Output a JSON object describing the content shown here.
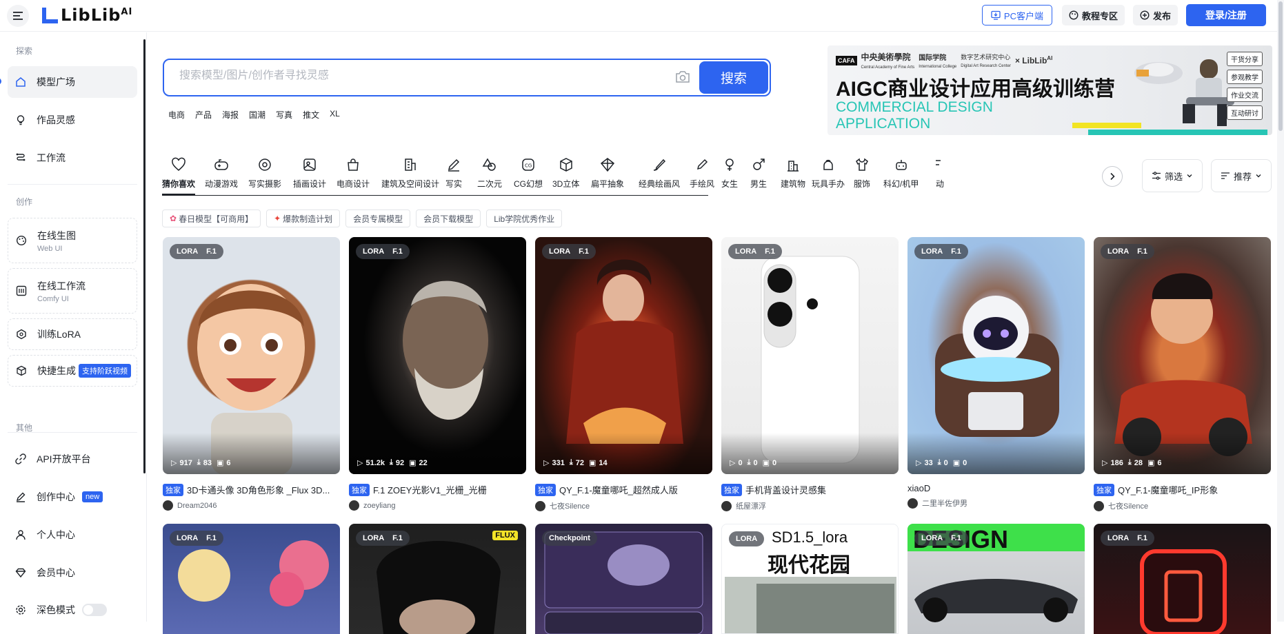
{
  "brand": {
    "logo_text": "LibLib",
    "logo_sup": "AI"
  },
  "header": {
    "client_btn": "PC客户端",
    "tutorial_btn": "教程专区",
    "publish_btn": "发布",
    "login_btn": "登录/注册"
  },
  "sidebar": {
    "section_explore": "探索",
    "explore_items": [
      {
        "label": "模型广场"
      },
      {
        "label": "作品灵感"
      },
      {
        "label": "工作流"
      }
    ],
    "section_create": "创作",
    "create_items": [
      {
        "label": "在线生图",
        "sub": "Web UI"
      },
      {
        "label": "在线工作流",
        "sub": "Comfy UI"
      },
      {
        "label": "训练LoRA"
      },
      {
        "label": "快捷生成",
        "tag": "支持阶跃视频"
      }
    ],
    "section_other": "其他",
    "other_items": [
      {
        "label": "API开放平台"
      },
      {
        "label": "创作中心",
        "tag": "new"
      },
      {
        "label": "个人中心"
      },
      {
        "label": "会员中心"
      },
      {
        "label": "深色模式"
      }
    ]
  },
  "search": {
    "placeholder": "搜索模型/图片/创作者寻找灵感",
    "button": "搜索",
    "quick_tags": [
      "电商",
      "产品",
      "海报",
      "国潮",
      "写真",
      "推文",
      "XL"
    ]
  },
  "banner": {
    "org1": "中央美術學院",
    "org1_en": "Central Academy of Fine Arts",
    "org2": "国际学院",
    "org2_en": "International College",
    "org3": "数字艺术研究中心",
    "org3_en": "Digital Art Research Center",
    "headline": "AIGC商业设计应用高级训练营",
    "en_line1": "COMMERCIAL DESIGN",
    "en_line2": "APPLICATION",
    "tags": [
      "干货分享",
      "参观教学",
      "作业交流",
      "互动研讨"
    ]
  },
  "categories": [
    {
      "label": "猜你喜欢",
      "icon": "heart-icon"
    },
    {
      "label": "动漫游戏",
      "icon": "gamepad-icon"
    },
    {
      "label": "写实摄影",
      "icon": "camera-icon"
    },
    {
      "label": "插画设计",
      "icon": "picture-icon"
    },
    {
      "label": "电商设计",
      "icon": "bag-icon"
    },
    {
      "label": "建筑及空间设计",
      "icon": "building-icon"
    },
    {
      "label": "写实",
      "icon": "pen-icon"
    },
    {
      "label": "二次元",
      "icon": "shapes-icon"
    },
    {
      "label": "CG幻想",
      "icon": "cg-icon"
    },
    {
      "label": "3D立体",
      "icon": "cube-icon"
    },
    {
      "label": "扁平抽象",
      "icon": "gem-icon"
    },
    {
      "label": "经典绘画风",
      "icon": "brush-icon"
    },
    {
      "label": "手绘风",
      "icon": "pencil-icon"
    },
    {
      "label": "女生",
      "icon": "female-icon"
    },
    {
      "label": "男生",
      "icon": "male-icon"
    },
    {
      "label": "建筑物",
      "icon": "city-icon"
    },
    {
      "label": "玩具手办",
      "icon": "toy-icon"
    },
    {
      "label": "服饰",
      "icon": "shirt-icon"
    },
    {
      "label": "科幻/机甲",
      "icon": "robot-icon"
    },
    {
      "label": "动",
      "icon": "more-icon"
    }
  ],
  "filter_btn": "筛选",
  "sort_btn": "推荐",
  "pills": [
    "春日模型【可商用】",
    "爆款制造计划",
    "会员专属模型",
    "会员下载模型",
    "Lib学院优秀作业"
  ],
  "cards": [
    {
      "badge1": "LORA",
      "badge2": "F.1",
      "runs": "917",
      "downloads": "83",
      "works": "6",
      "exclusive": "独家",
      "title": "3D卡通头像 3D角色形象 _Flux 3D...",
      "author": "Dream2046"
    },
    {
      "badge1": "LORA",
      "badge2": "F.1",
      "runs": "51.2k",
      "downloads": "92",
      "works": "22",
      "exclusive": "独家",
      "title": "F.1 ZOEY光影V1_光栅_光栅",
      "author": "zoeyliang"
    },
    {
      "badge1": "LORA",
      "badge2": "F.1",
      "runs": "331",
      "downloads": "72",
      "works": "14",
      "exclusive": "独家",
      "title": "QY_F.1-魔童哪吒_超然成人版",
      "author": "七夜Silence"
    },
    {
      "badge1": "LORA",
      "badge2": "F.1",
      "runs": "0",
      "downloads": "0",
      "works": "0",
      "exclusive": "独家",
      "title": "手机背盖设计灵感集",
      "author": "纸屋漂浮"
    },
    {
      "badge1": "LORA",
      "badge2": "F.1",
      "runs": "33",
      "downloads": "0",
      "works": "0",
      "exclusive": "",
      "title": "xiaoD",
      "author": "二里半佐伊男"
    },
    {
      "badge1": "LORA",
      "badge2": "F.1",
      "runs": "186",
      "downloads": "28",
      "works": "6",
      "exclusive": "独家",
      "title": "QY_F.1-魔童哪吒_IP形象",
      "author": "七夜Silence"
    }
  ],
  "cards_row2": [
    {
      "badge1": "LORA",
      "badge2": "F.1"
    },
    {
      "badge1": "LORA",
      "badge2": "F.1",
      "corner": "FLUX"
    },
    {
      "badge1": "Checkpoint",
      "badge2": ""
    },
    {
      "badge1": "LORA",
      "badge2": "",
      "overlay1": "SD1.5_lora",
      "overlay2": "现代花园"
    },
    {
      "badge1": "LORA",
      "badge2": "F.1",
      "overlay1": "DESIGN"
    },
    {
      "badge1": "LORA",
      "badge2": "F.1"
    }
  ]
}
